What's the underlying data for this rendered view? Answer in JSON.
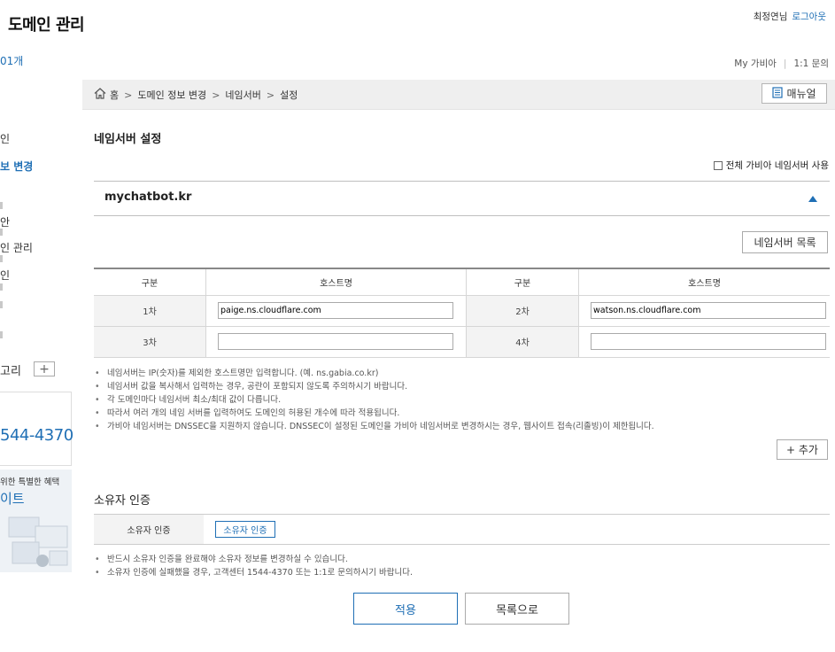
{
  "header": {
    "title": "도메인 관리",
    "count": "01개",
    "user_name": "최정연님",
    "logout": "로그아웃",
    "links": [
      "My 가비아",
      "1:1 문의"
    ]
  },
  "breadcrumb": {
    "items": [
      "홈",
      "도메인 정보 변경",
      "네임서버",
      "설정"
    ],
    "manual_button": "매뉴얼"
  },
  "sidebar": {
    "items": [
      {
        "label": "인",
        "active": false
      },
      {
        "label": "보 변경",
        "active": true
      },
      {
        "label": "안",
        "active": false
      },
      {
        "label": "인 관리",
        "active": false
      },
      {
        "label": "인",
        "active": false
      }
    ],
    "category_label": "고리",
    "category_add": "+",
    "banner_phone": "544-4370",
    "banner2_line1": "위한 특별한 혜택",
    "banner2_line2": "이트"
  },
  "nameserver": {
    "section_title": "네임서버 설정",
    "use_all_gabia_label": "전체 가비아 네임서버 사용",
    "domain": "mychatbot.kr",
    "list_button": "네임서버 목록",
    "headers": {
      "type": "구분",
      "host": "호스트명"
    },
    "rows": [
      {
        "left_label": "1차",
        "left_value": "paige.ns.cloudflare.com",
        "right_label": "2차",
        "right_value": "watson.ns.cloudflare.com"
      },
      {
        "left_label": "3차",
        "left_value": "",
        "right_label": "4차",
        "right_value": ""
      }
    ],
    "notes": [
      "네임서버는 IP(숫자)를 제외한 호스트명만 입력합니다. (예. ns.gabia.co.kr)",
      "네임서버 값을 복사해서 입력하는 경우, 공란이 포함되지 않도록 주의하시기 바랍니다.",
      "각 도메인마다 네임서버 최소/최대 값이 다릅니다.",
      "따라서 여러 개의 네임 서버를 입력하여도 도메인의 허용된 개수에 따라 적용됩니다.",
      "가비아 네임서버는 DNSSEC을 지원하지 않습니다. DNSSEC이 설정된 도메인을 가비아 네임서버로 변경하시는 경우, 웹사이트 접속(리졸빙)이 제한됩니다."
    ],
    "add_button": "+ 추가"
  },
  "owner": {
    "section_title": "소유자 인증",
    "label": "소유자 인증",
    "button": "소유자 인증",
    "notes": [
      "반드시 소유자 인증을 완료해야 소유자 정보를 변경하실 수 있습니다.",
      "소유자 인증에 실패했을 경우, 고객센터 1544-4370 또는 1:1로 문의하시기 바랍니다."
    ]
  },
  "actions": {
    "apply": "적용",
    "list": "목록으로"
  },
  "colors": {
    "accent": "#1f6fb5",
    "breadcrumb_bg": "#efefef",
    "label_bg": "#f3f3f3"
  }
}
